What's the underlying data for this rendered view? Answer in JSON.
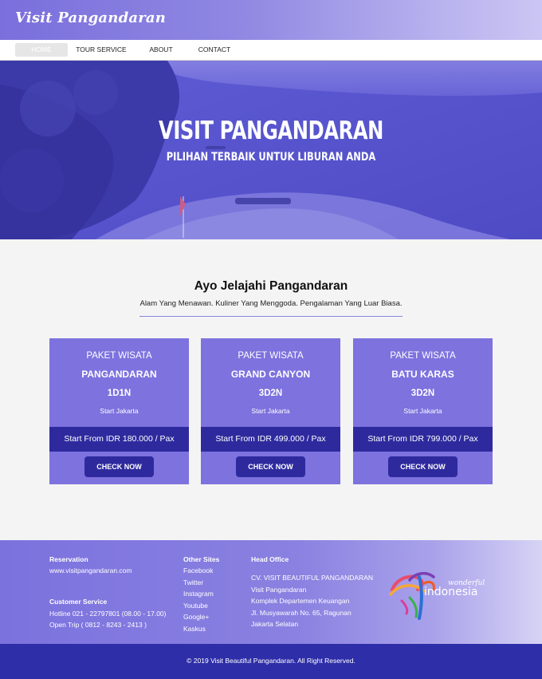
{
  "brand": {
    "logo_text": "Visit Pangandaran"
  },
  "nav": {
    "items": [
      {
        "label": "HOME"
      },
      {
        "label": "TOUR SERVICE"
      },
      {
        "label": "ABOUT"
      },
      {
        "label": "CONTACT"
      }
    ],
    "active": "HOME"
  },
  "hero": {
    "title": "VISIT PANGANDARAN",
    "subtitle": "PILIHAN TERBAIK UNTUK LIBURAN ANDA"
  },
  "intro": {
    "title": "Ayo Jelajahi Pangandaran",
    "subtitle": "Alam Yang Menawan. Kuliner Yang Menggoda. Pengalaman Yang Luar Biasa."
  },
  "packages": [
    {
      "label": "PAKET WISATA",
      "name": "PANGANDARAN",
      "duration": "1D1N",
      "start": "Start Jakarta",
      "price": "Start From IDR 180.000 / Pax",
      "button": "CHECK NOW"
    },
    {
      "label": "PAKET WISATA",
      "name": "GRAND CANYON",
      "duration": "3D2N",
      "start": "Start Jakarta",
      "price": "Start From IDR 499.000 / Pax",
      "button": "CHECK NOW"
    },
    {
      "label": "PAKET WISATA",
      "name": "BATU KARAS",
      "duration": "3D2N",
      "start": "Start Jakarta",
      "price": "Start From IDR 799.000 / Pax",
      "button": "CHECK NOW"
    }
  ],
  "footer": {
    "reservation": {
      "heading": "Reservation",
      "site": "www.visitpangandaran.com"
    },
    "customer_service": {
      "heading": "Customer Service",
      "hotline": "Hotline 021 - 22797801 (08.00 - 17.00)",
      "open_trip": "Open Trip ( 0812 - 8243 - 2413 )"
    },
    "other_sites": {
      "heading": "Other Sites",
      "links": [
        "Facebook",
        "Twitter",
        "Instagram",
        "Youtube",
        "Google+",
        "Kaskus"
      ]
    },
    "head_office": {
      "heading": "Head Office",
      "lines": [
        "CV. VISIT BEAUTIFUL PANGANDARAN",
        "Visit Pangandaran",
        "Komplek Departemen Keuangan",
        "Jl. Musyawarah No. 65, Ragunan",
        "Jakarta Selatan"
      ]
    },
    "partner_logo": {
      "small": "wonderful",
      "big": "indonesia"
    },
    "copyright": "© 2019 Visit Beautiful Pangandaran. All Right Reserved."
  },
  "colors": {
    "accent": "#7d72de",
    "dark_accent": "#2e2a9e",
    "bottom_bar": "#2e2ea8",
    "hero_tint": "#5b58d0",
    "background": "#f4f4f4"
  }
}
